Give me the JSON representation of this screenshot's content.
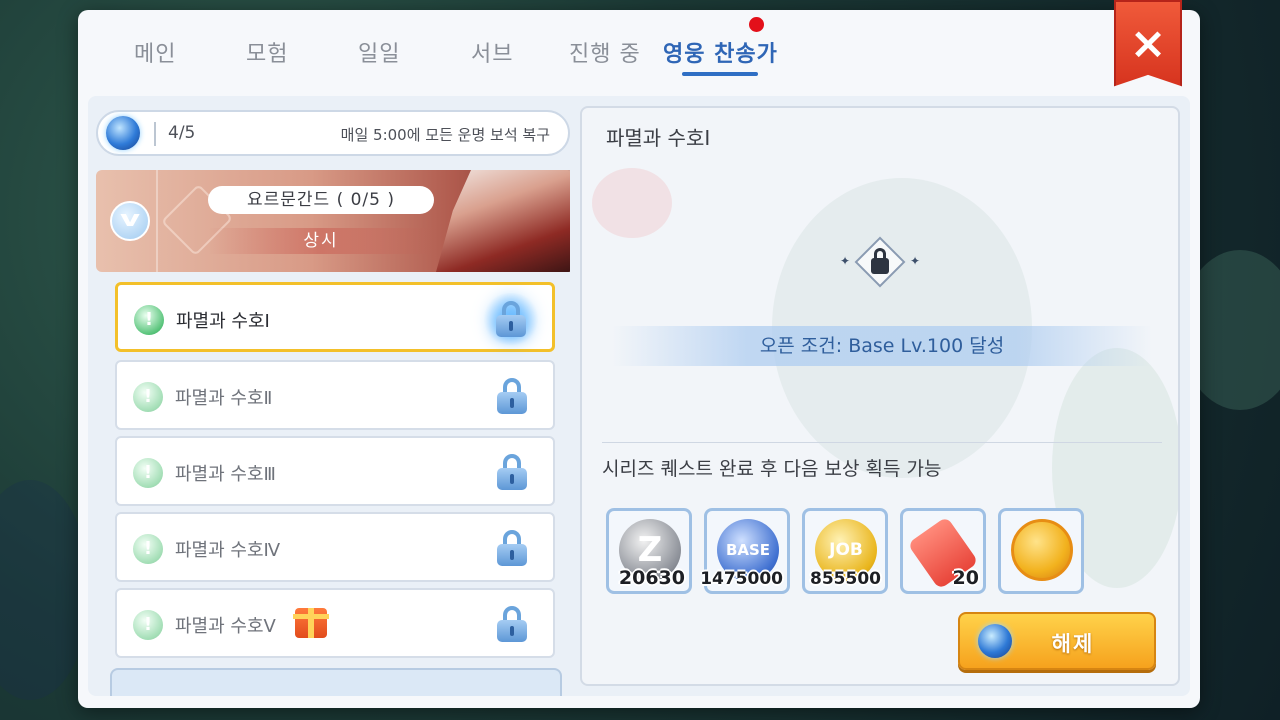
{
  "tabs": [
    {
      "label": "메인"
    },
    {
      "label": "모험"
    },
    {
      "label": "일일"
    },
    {
      "label": "서브"
    },
    {
      "label": "진행 중"
    },
    {
      "label": "영웅 찬송가",
      "active": true,
      "notification": true
    }
  ],
  "close_icon": "×",
  "gem_bar": {
    "icon": "fate-gem-icon",
    "count": "4/5",
    "note": "매일 5:00에 모든 운명 보석 복구"
  },
  "chapter": {
    "title": "요르문간드 ( 0/5 )",
    "subtitle": "상시",
    "expanded": true
  },
  "quests": [
    {
      "label": "파멸과 수호Ⅰ",
      "selected": true,
      "locked": true
    },
    {
      "label": "파멸과 수호Ⅱ",
      "selected": false,
      "locked": true
    },
    {
      "label": "파멸과 수호Ⅲ",
      "selected": false,
      "locked": true
    },
    {
      "label": "파멸과 수호Ⅳ",
      "selected": false,
      "locked": true
    },
    {
      "label": "파멸과 수호Ⅴ",
      "selected": false,
      "locked": true,
      "gift": true
    }
  ],
  "detail": {
    "title": "파멸과 수호Ⅰ",
    "open_condition": "오픈 조건: Base Lv.100 달성",
    "reward_note": "시리즈 퀘스트 완료 후 다음 보상 획득 가능",
    "rewards": [
      {
        "name": "zeny-coin",
        "symbol": "Z",
        "amount": "20630",
        "color": "#9a9ea6"
      },
      {
        "name": "base-exp-coin",
        "symbol": "BASE",
        "amount": "1475000",
        "color": "#3e6fd0"
      },
      {
        "name": "job-exp-coin",
        "symbol": "JOB",
        "amount": "855500",
        "color": "#e9b51c"
      },
      {
        "name": "ticket",
        "symbol": "",
        "amount": "20",
        "color": "#e8453a"
      },
      {
        "name": "gold-medal",
        "symbol": "",
        "amount": "",
        "color": "#f2b21e"
      }
    ],
    "release_button": "해제"
  }
}
